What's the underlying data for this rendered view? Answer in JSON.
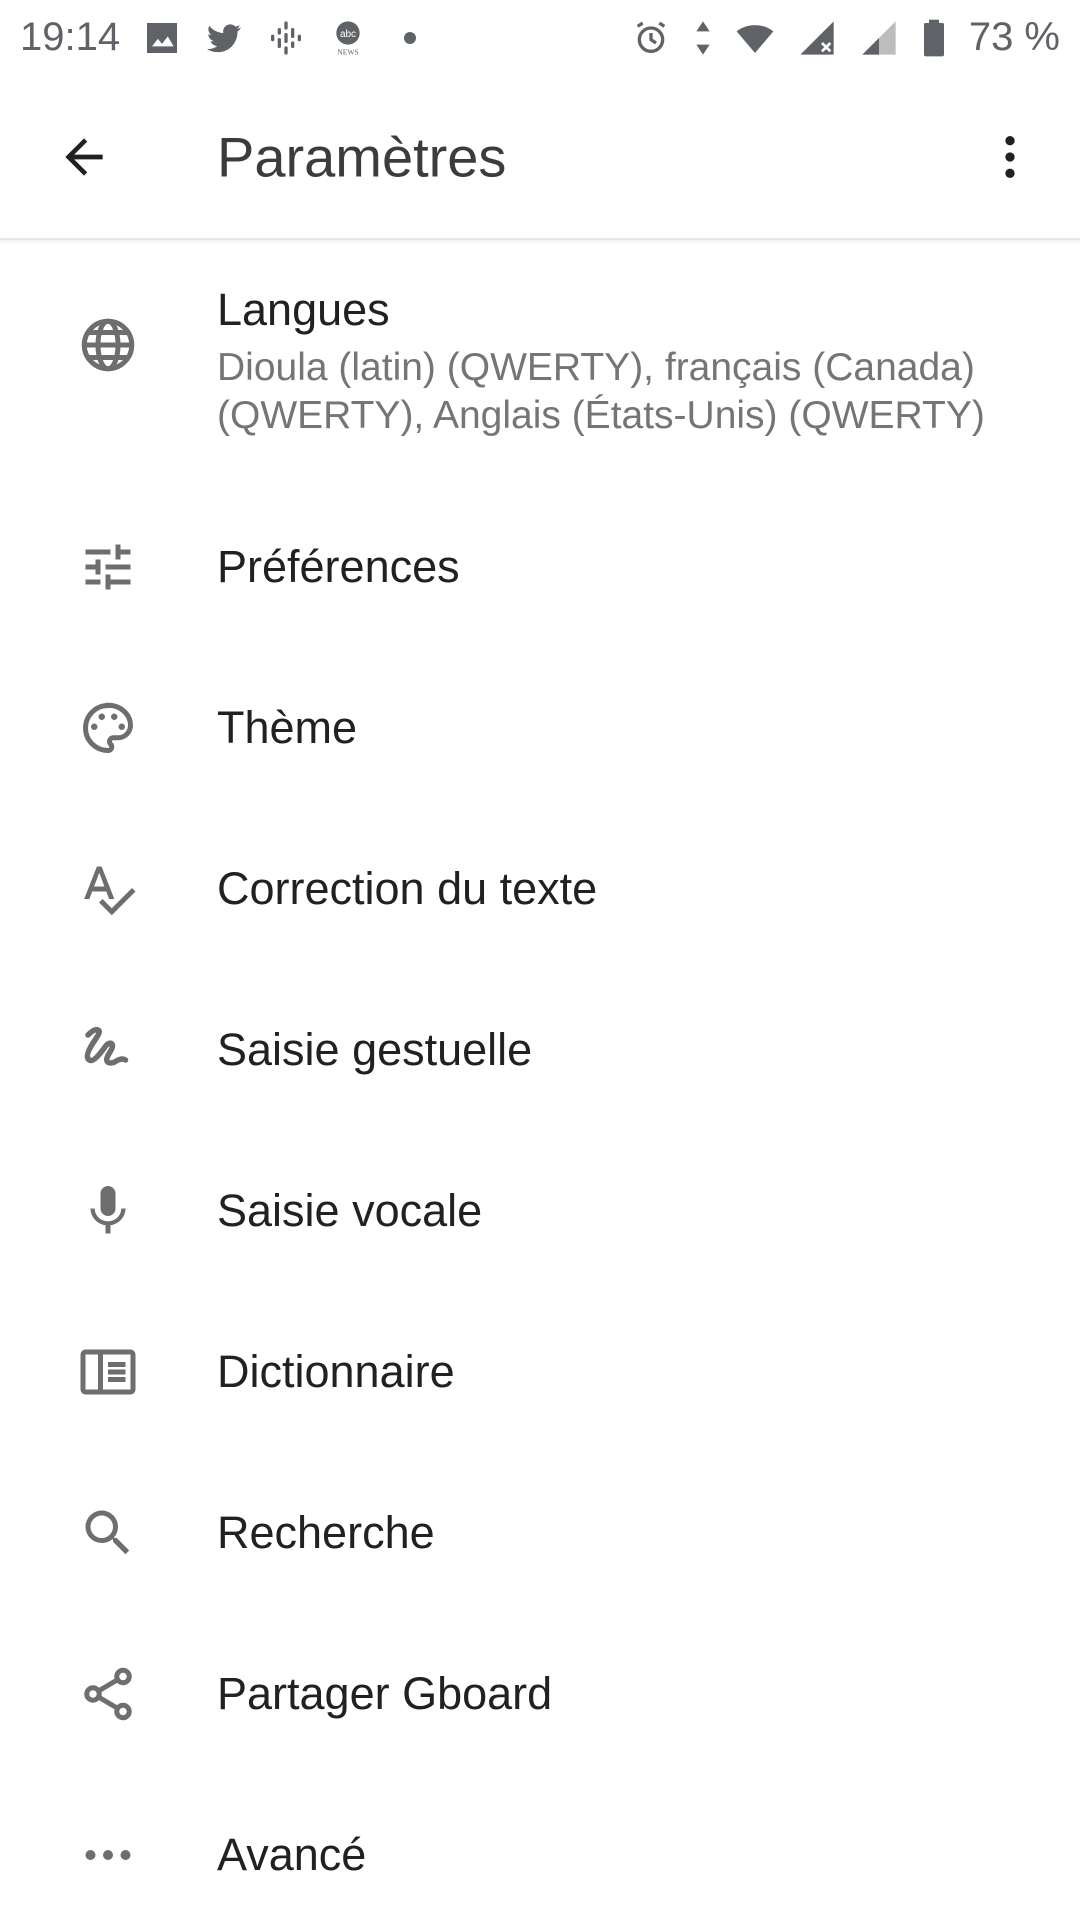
{
  "status_bar": {
    "time": "19:14",
    "notification_icons": [
      "image-icon",
      "twitter-icon",
      "podcasts-icon",
      "abc-news-icon",
      "dot-icon"
    ],
    "system_icons": [
      "alarm-icon",
      "data-arrows-icon",
      "wifi-icon",
      "signal-icon",
      "signal-icon",
      "battery-icon"
    ],
    "battery": "73 %"
  },
  "app_bar": {
    "title": "Paramètres",
    "back_icon": "arrow-back-icon",
    "more_icon": "more-vert-icon"
  },
  "settings": [
    {
      "icon": "globe-icon",
      "title": "Langues",
      "subtitle": "Dioula (latin) (QWERTY), français (Canada) (QWERTY), Anglais (États-Unis) (QWERTY)"
    },
    {
      "icon": "tune-icon",
      "title": "Préférences"
    },
    {
      "icon": "palette-icon",
      "title": "Thème"
    },
    {
      "icon": "spellcheck-icon",
      "title": "Correction du texte"
    },
    {
      "icon": "gesture-icon",
      "title": "Saisie gestuelle"
    },
    {
      "icon": "microphone-icon",
      "title": "Saisie vocale"
    },
    {
      "icon": "dictionary-icon",
      "title": "Dictionnaire"
    },
    {
      "icon": "search-icon",
      "title": "Recherche"
    },
    {
      "icon": "share-icon",
      "title": "Partager Gboard"
    },
    {
      "icon": "more-horiz-icon",
      "title": "Avancé"
    }
  ],
  "colors": {
    "icon": "#6e6e6e",
    "title_text": "#212121",
    "subtitle_text": "#757575",
    "status_bar_text": "#5f6368"
  }
}
